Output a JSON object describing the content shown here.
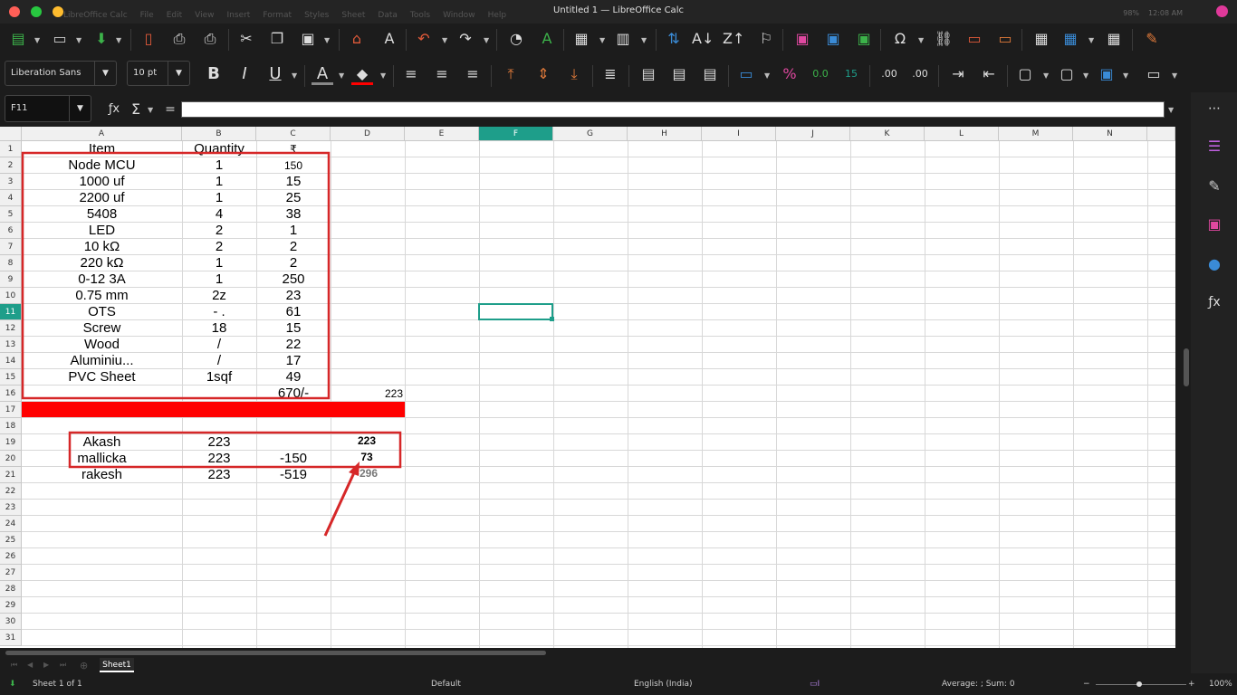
{
  "window": {
    "title": "Untitled 1 — LibreOffice Calc"
  },
  "menu": [
    "LibreOffice Calc",
    "File",
    "Edit",
    "View",
    "Insert",
    "Format",
    "Styles",
    "Sheet",
    "Data",
    "Tools",
    "Window",
    "Help"
  ],
  "system": {
    "battery": "98%",
    "time": "12:08 AM"
  },
  "format": {
    "font_name": "Liberation Sans",
    "font_size": "10 pt"
  },
  "formula": {
    "cell_ref": "F11",
    "content": ""
  },
  "columns": [
    "A",
    "B",
    "C",
    "D",
    "E",
    "F",
    "G",
    "H",
    "I",
    "J",
    "K",
    "L",
    "M",
    "N"
  ],
  "selected_column": "F",
  "rows": [
    "1",
    "2",
    "3",
    "4",
    "5",
    "6",
    "7",
    "8",
    "9",
    "10",
    "11",
    "12",
    "13",
    "14",
    "15",
    "16",
    "17",
    "18",
    "19",
    "20",
    "21",
    "22",
    "23",
    "24",
    "25",
    "26",
    "27",
    "28",
    "29",
    "30",
    "31"
  ],
  "selected_row": "11",
  "table": {
    "headers": {
      "item": "Item",
      "quantity": "Quantity",
      "price": "₹"
    },
    "rows": [
      {
        "item": "Node MCU",
        "qty": "1",
        "price": "150"
      },
      {
        "item": "1000 uf",
        "qty": "1",
        "price": "15"
      },
      {
        "item": "2200 uf",
        "qty": "1",
        "price": "25"
      },
      {
        "item": "5408",
        "qty": "4",
        "price": "38"
      },
      {
        "item": "LED",
        "qty": "2",
        "price": "1"
      },
      {
        "item": "10 kΩ",
        "qty": "2",
        "price": "2"
      },
      {
        "item": "220 kΩ",
        "qty": "1",
        "price": "2"
      },
      {
        "item": "0-12 3A",
        "qty": "1",
        "price": "250"
      },
      {
        "item": "0.75 mm",
        "qty": "2z",
        "price": "23"
      },
      {
        "item": "OTS",
        "qty": "- .",
        "price": "61"
      },
      {
        "item": "Screw",
        "qty": "18",
        "price": "15"
      },
      {
        "item": "Wood",
        "qty": "/",
        "price": "22"
      },
      {
        "item": "Aluminiu...",
        "qty": "/",
        "price": "17"
      },
      {
        "item": "PVC Sheet",
        "qty": "1sqf",
        "price": "49"
      }
    ],
    "total": "670/-",
    "d16": "223"
  },
  "people": [
    {
      "name": "Akash",
      "b": "223",
      "c": "",
      "d": "223"
    },
    {
      "name": "mallicka",
      "b": "223",
      "c": "-150",
      "d": "73"
    },
    {
      "name": "rakesh",
      "b": "223",
      "c": "-519",
      "d": "-296"
    }
  ],
  "sheet_tab": "Sheet1",
  "status": {
    "sheet": "Sheet 1 of 1",
    "style": "Default",
    "language": "English (India)",
    "summary": "Average: ; Sum: 0",
    "zoom": "100%"
  },
  "colors": {
    "accent": "#1e9e8a",
    "highlight_red": "#ff0000",
    "annotation": "#d62728"
  }
}
